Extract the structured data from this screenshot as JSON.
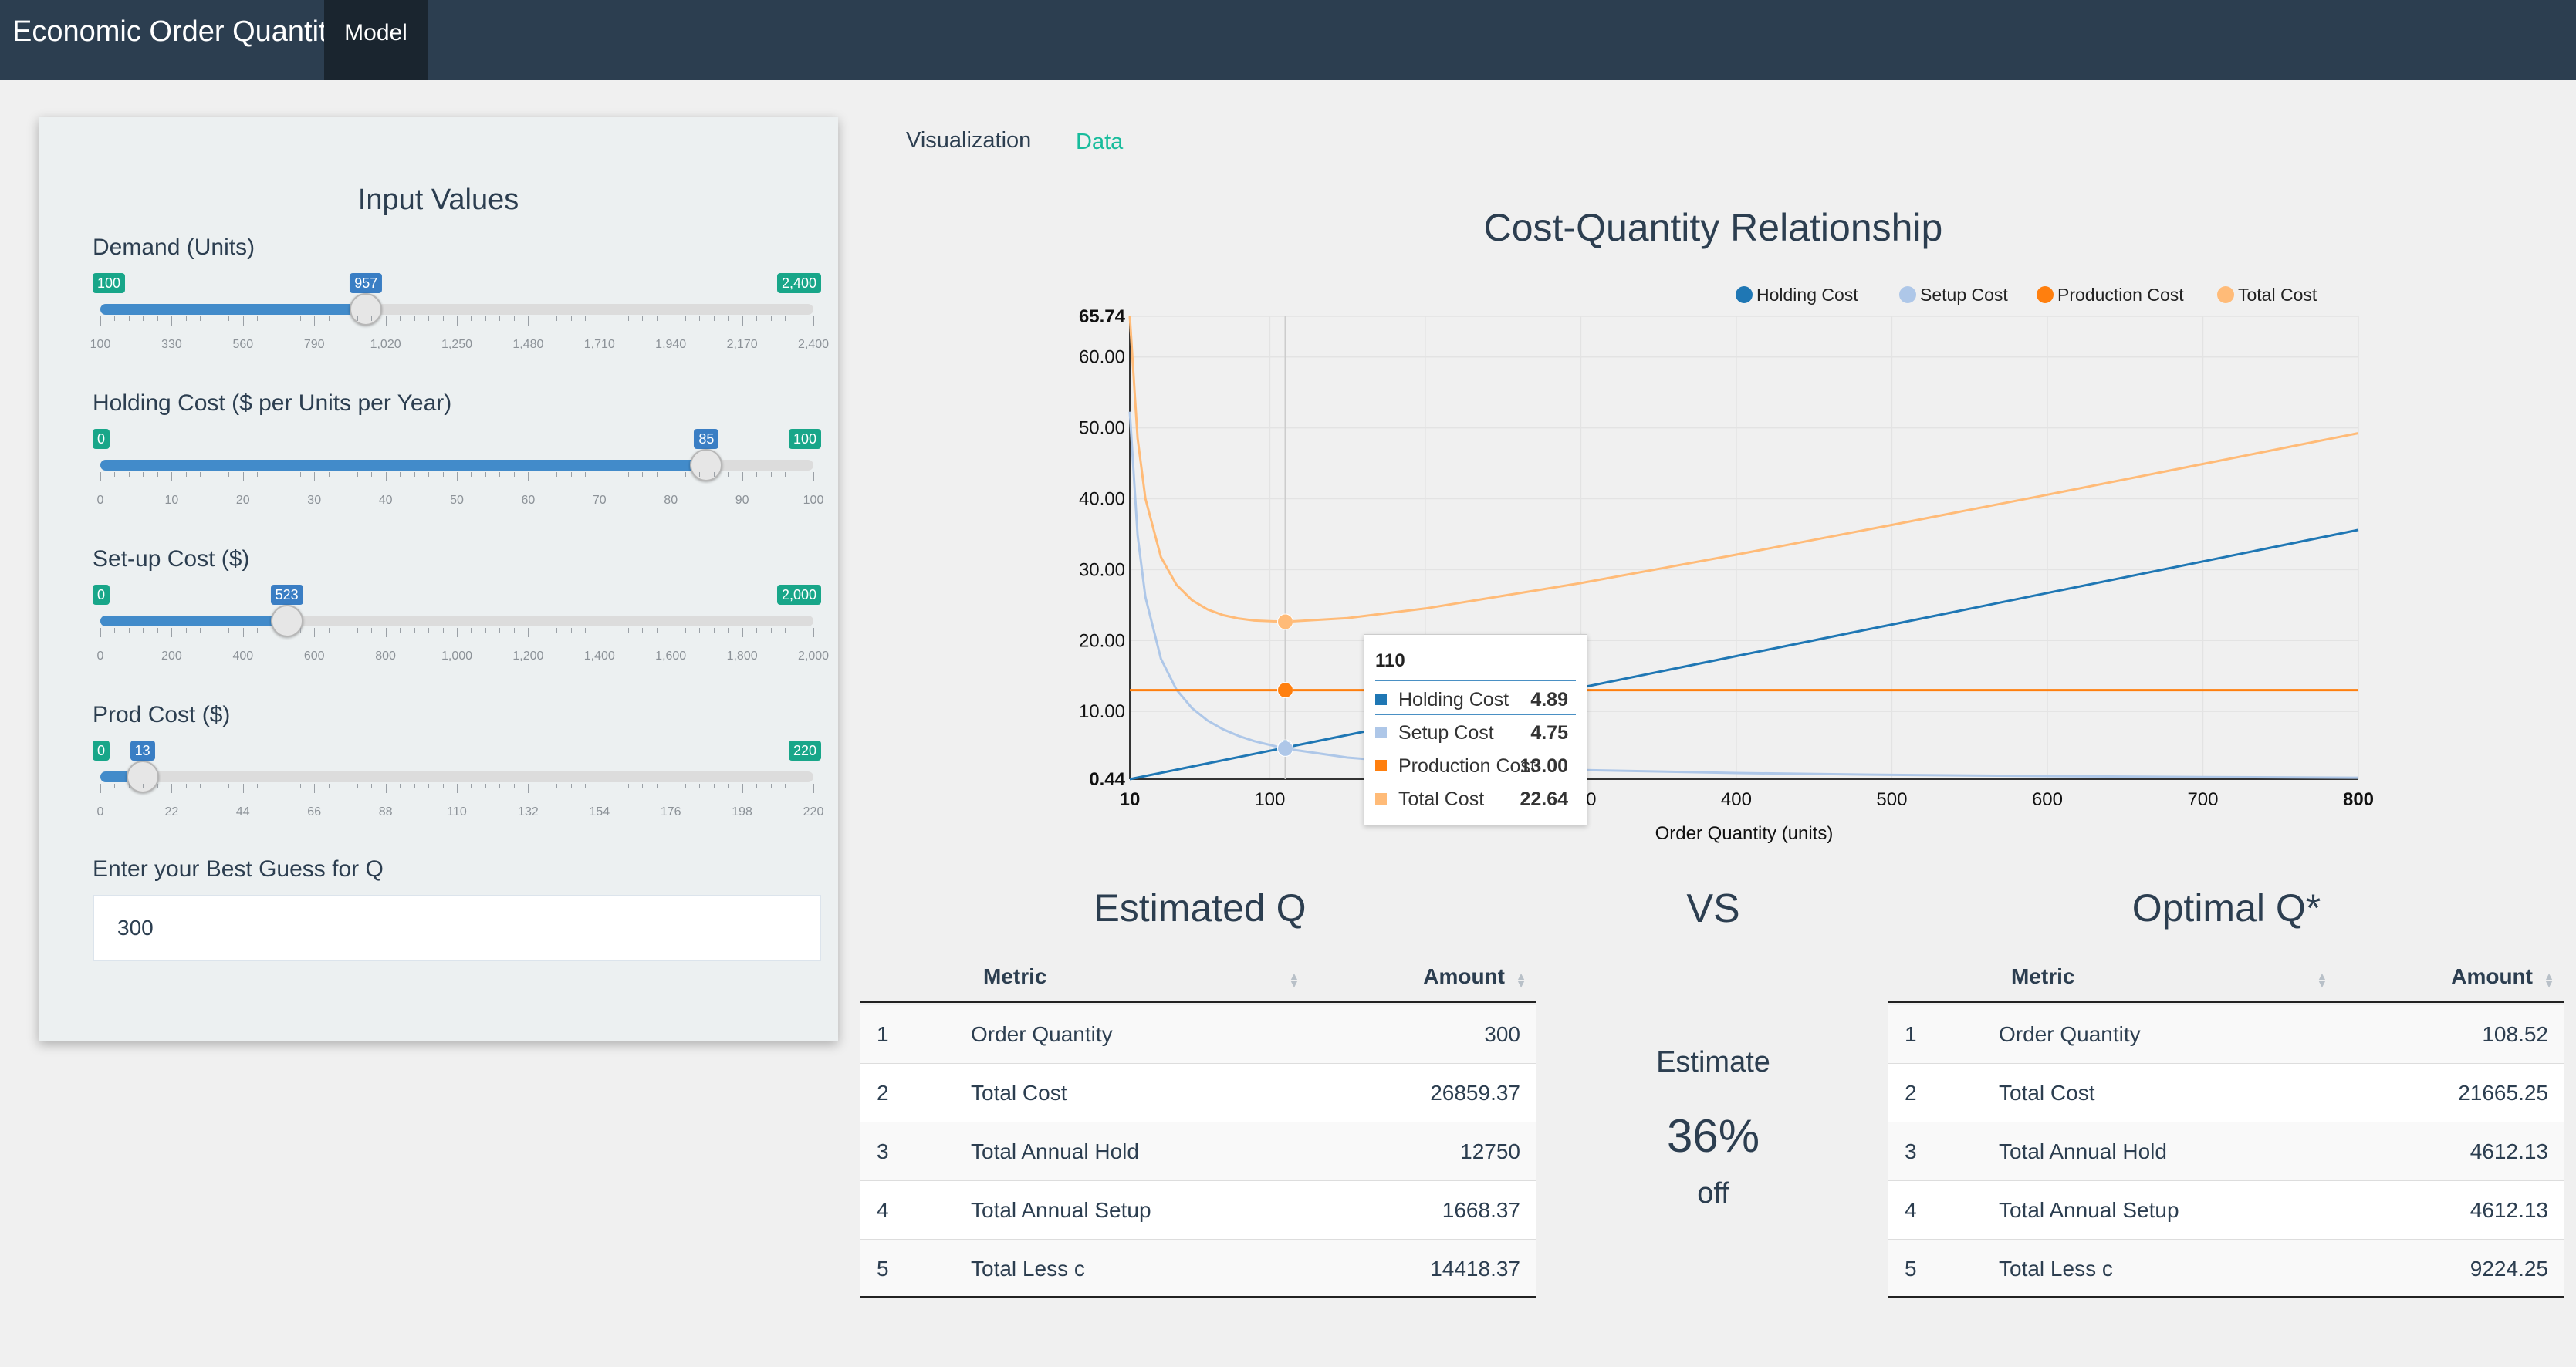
{
  "app": {
    "title": "Economic Order Quantity",
    "model_tab": "Model"
  },
  "panel": {
    "title": "Input Values"
  },
  "sliders": [
    {
      "label": "Demand (Units)",
      "min": 100,
      "max": 2400,
      "value": 957,
      "min_label": "100",
      "max_label": "2,400",
      "value_label": "957",
      "ticks": [
        "100",
        "330",
        "560",
        "790",
        "1,020",
        "1,250",
        "1,480",
        "1,710",
        "1,940",
        "2,170",
        "2,400"
      ]
    },
    {
      "label": "Holding Cost ($ per Units per Year)",
      "min": 0,
      "max": 100,
      "value": 85,
      "min_label": "0",
      "max_label": "100",
      "value_label": "85",
      "ticks": [
        "0",
        "10",
        "20",
        "30",
        "40",
        "50",
        "60",
        "70",
        "80",
        "90",
        "100"
      ]
    },
    {
      "label": "Set-up Cost ($)",
      "min": 0,
      "max": 2000,
      "value": 523,
      "min_label": "0",
      "max_label": "2,000",
      "value_label": "523",
      "ticks": [
        "0",
        "200",
        "400",
        "600",
        "800",
        "1,000",
        "1,200",
        "1,400",
        "1,600",
        "1,800",
        "2,000"
      ]
    },
    {
      "label": "Prod Cost ($)",
      "min": 0,
      "max": 220,
      "value": 13,
      "min_label": "0",
      "max_label": "220",
      "value_label": "13",
      "ticks": [
        "0",
        "22",
        "44",
        "66",
        "88",
        "110",
        "132",
        "154",
        "176",
        "198",
        "220"
      ]
    }
  ],
  "guess": {
    "label": "Enter your Best Guess for Q",
    "value": "300"
  },
  "tabs": {
    "visualization": "Visualization",
    "data": "Data"
  },
  "chart_data": {
    "type": "line",
    "title": "Cost-Quantity Relationship",
    "xlabel": "Order Quantity (units)",
    "ylabel": "",
    "xlim": [
      10,
      800
    ],
    "ylim": [
      0.44,
      65.74
    ],
    "x_ticks": [
      "10",
      "100",
      "200",
      "300",
      "400",
      "500",
      "600",
      "700",
      "800"
    ],
    "y_ticks": [
      "0.44",
      "10.00",
      "20.00",
      "30.00",
      "40.00",
      "50.00",
      "60.00",
      "65.74"
    ],
    "legend_position": "top-right",
    "grid": true,
    "series": [
      {
        "name": "Holding Cost",
        "color": "#1f77b4",
        "points": [
          [
            10,
            0.44
          ],
          [
            100,
            4.45
          ],
          [
            200,
            8.9
          ],
          [
            300,
            13.35
          ],
          [
            400,
            17.8
          ],
          [
            500,
            22.25
          ],
          [
            600,
            26.7
          ],
          [
            700,
            31.15
          ],
          [
            800,
            35.6
          ]
        ]
      },
      {
        "name": "Setup Cost",
        "color": "#aec7e8",
        "points": [
          [
            10,
            52.28
          ],
          [
            15,
            34.85
          ],
          [
            20,
            26.14
          ],
          [
            30,
            17.43
          ],
          [
            40,
            13.07
          ],
          [
            50,
            10.46
          ],
          [
            60,
            8.71
          ],
          [
            70,
            7.47
          ],
          [
            80,
            6.54
          ],
          [
            90,
            5.81
          ],
          [
            110,
            4.75
          ],
          [
            150,
            3.49
          ],
          [
            200,
            2.61
          ],
          [
            300,
            1.74
          ],
          [
            400,
            1.31
          ],
          [
            500,
            1.05
          ],
          [
            600,
            0.87
          ],
          [
            700,
            0.75
          ],
          [
            800,
            0.65
          ]
        ]
      },
      {
        "name": "Production Cost",
        "color": "#ff7f0e",
        "points": [
          [
            10,
            13.0
          ],
          [
            800,
            13.0
          ]
        ]
      },
      {
        "name": "Total Cost",
        "color": "#ffbb78",
        "points": [
          [
            10,
            65.74
          ],
          [
            15,
            48.52
          ],
          [
            20,
            40.03
          ],
          [
            30,
            31.77
          ],
          [
            40,
            27.85
          ],
          [
            50,
            25.69
          ],
          [
            60,
            24.38
          ],
          [
            70,
            23.58
          ],
          [
            80,
            23.1
          ],
          [
            90,
            22.82
          ],
          [
            110,
            22.64
          ],
          [
            150,
            23.16
          ],
          [
            200,
            24.51
          ],
          [
            300,
            28.09
          ],
          [
            400,
            32.11
          ],
          [
            500,
            36.3
          ],
          [
            600,
            40.57
          ],
          [
            700,
            44.9
          ],
          [
            800,
            49.25
          ]
        ]
      }
    ],
    "hover": {
      "x_label": "110",
      "rows": [
        {
          "name": "Holding Cost",
          "value": "4.89",
          "color": "#1f77b4"
        },
        {
          "name": "Setup Cost",
          "value": "4.75",
          "color": "#aec7e8"
        },
        {
          "name": "Production Cost",
          "value": "13.00",
          "color": "#ff7f0e"
        },
        {
          "name": "Total Cost",
          "value": "22.64",
          "color": "#ffbb78"
        }
      ]
    }
  },
  "estimated": {
    "title": "Estimated Q",
    "headers": [
      "Metric",
      "Amount"
    ],
    "rows": [
      [
        "1",
        "Order Quantity",
        "300"
      ],
      [
        "2",
        "Total Cost",
        "26859.37"
      ],
      [
        "3",
        "Total Annual Hold",
        "12750"
      ],
      [
        "4",
        "Total Annual Setup",
        "1668.37"
      ],
      [
        "5",
        "Total Less c",
        "14418.37"
      ]
    ]
  },
  "vs": "VS",
  "estimate": {
    "word": "Estimate",
    "percent": "36%",
    "off": "off"
  },
  "optimal": {
    "title": "Optimal Q*",
    "headers": [
      "Metric",
      "Amount"
    ],
    "rows": [
      [
        "1",
        "Order Quantity",
        "108.52"
      ],
      [
        "2",
        "Total Cost",
        "21665.25"
      ],
      [
        "3",
        "Total Annual Hold",
        "4612.13"
      ],
      [
        "4",
        "Total Annual Setup",
        "4612.13"
      ],
      [
        "5",
        "Total Less c",
        "9224.25"
      ]
    ]
  }
}
